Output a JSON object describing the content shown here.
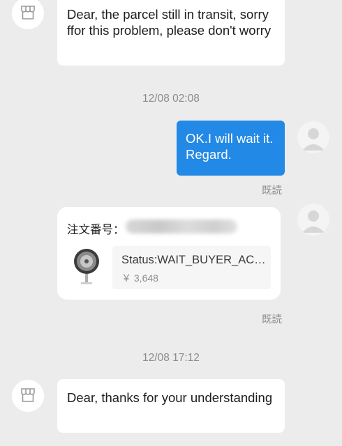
{
  "messages": {
    "first": "Dear, the parcel still in transit, sorry ffor this problem, please don't worry",
    "reply": "OK.I will wait it. Regard.",
    "last": "Dear, thanks for your understanding"
  },
  "timestamps": {
    "first": "12/08 02:08",
    "second": "12/08 17:12"
  },
  "read_receipt": "既読",
  "order": {
    "label": "注文番号：",
    "status": "Status:WAIT_BUYER_ACCEPT_GOODS",
    "price": "￥ 3,648"
  },
  "icons": {
    "shop_avatar": "storefront-icon",
    "user_avatar": "person-icon"
  },
  "colors": {
    "background": "#ececec",
    "outgoing_bubble": "#2289e6",
    "incoming_bubble": "#ffffff"
  }
}
